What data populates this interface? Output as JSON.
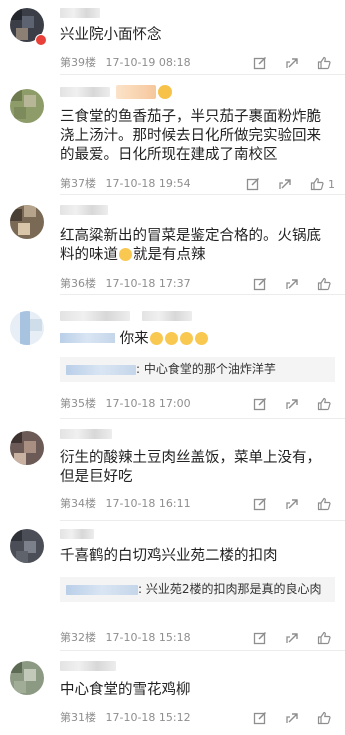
{
  "comments": [
    {
      "text": "兴业院小面怀念",
      "floor": "第39楼",
      "time": "17-10-19 08:18",
      "likes": ""
    },
    {
      "text": "三食堂的鱼香茄子，半只茄子裹面粉炸脆浇上汤汁。那时候去日化所做完实验回来的最爱。日化所现在建成了南校区",
      "floor": "第37楼",
      "time": "17-10-18 19:54",
      "likes": "1"
    },
    {
      "text_a": "红高粱新出的冒菜是鉴定合格的。火锅底料的味道",
      "text_b": "就是有点辣",
      "floor": "第36楼",
      "time": "17-10-18 17:37",
      "likes": ""
    },
    {
      "text": "你来",
      "quote": ": 中心食堂的那个油炸洋芋",
      "floor": "第35楼",
      "time": "17-10-18 17:00",
      "likes": ""
    },
    {
      "text": "衍生的酸辣土豆肉丝盖饭，菜单上没有，但是巨好吃",
      "floor": "第34楼",
      "time": "17-10-18 16:11",
      "likes": ""
    },
    {
      "text": "千喜鹤的白切鸡兴业苑二楼的扣肉",
      "quote": ": 兴业苑2楼的扣肉那是真的良心肉",
      "floor": "第32楼",
      "time": "17-10-18 15:18",
      "likes": ""
    },
    {
      "text": "中心食堂的雪花鸡柳",
      "floor": "第31楼",
      "time": "17-10-18 15:12",
      "likes": ""
    }
  ],
  "icons": {
    "edit": "edit-icon",
    "share": "share-icon",
    "like": "thumbs-up-icon"
  },
  "colors": {
    "meta": "#8e8e8e",
    "text": "#222222",
    "quote_bg": "#f4f4f4"
  }
}
